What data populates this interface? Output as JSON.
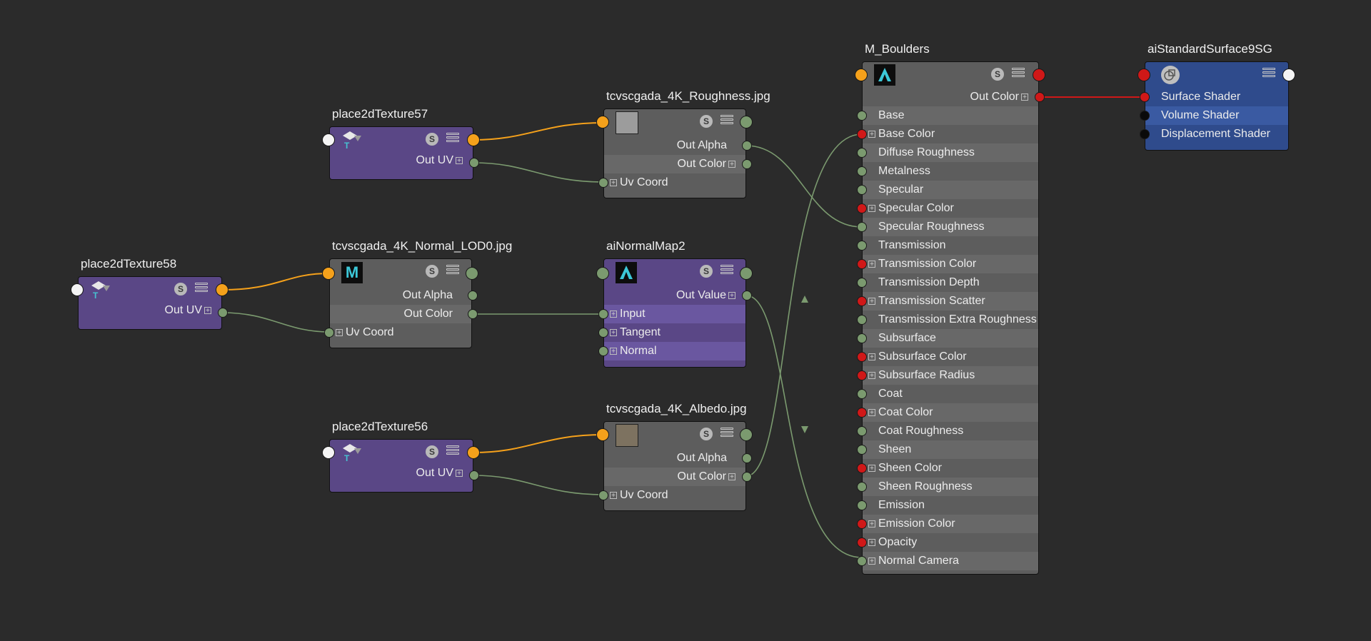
{
  "nodes": {
    "place2d57": {
      "title": "place2dTexture57",
      "out_uv": "Out UV"
    },
    "place2d58": {
      "title": "place2dTexture58",
      "out_uv": "Out UV"
    },
    "place2d56": {
      "title": "place2dTexture56",
      "out_uv": "Out UV"
    },
    "roughness": {
      "title": "tcvscgada_4K_Roughness.jpg",
      "out_alpha": "Out Alpha",
      "out_color": "Out Color",
      "uv_coord": "Uv Coord"
    },
    "normal_tex": {
      "title": "tcvscgada_4K_Normal_LOD0.jpg",
      "out_alpha": "Out Alpha",
      "out_color": "Out Color",
      "uv_coord": "Uv Coord"
    },
    "albedo": {
      "title": "tcvscgada_4K_Albedo.jpg",
      "out_alpha": "Out Alpha",
      "out_color": "Out Color",
      "uv_coord": "Uv Coord"
    },
    "normalmap": {
      "title": "aiNormalMap2",
      "out_value": "Out Value",
      "input": "Input",
      "tangent": "Tangent",
      "normal": "Normal"
    },
    "boulders": {
      "title": "M_Boulders",
      "out_color": "Out Color",
      "attrs": [
        "Base",
        "Base Color",
        "Diffuse Roughness",
        "Metalness",
        "Specular",
        "Specular Color",
        "Specular Roughness",
        "Transmission",
        "Transmission Color",
        "Transmission Depth",
        "Transmission Scatter",
        "Transmission Extra Roughness",
        "Subsurface",
        "Subsurface Color",
        "Subsurface Radius",
        "Coat",
        "Coat Color",
        "Coat Roughness",
        "Sheen",
        "Sheen Color",
        "Sheen Roughness",
        "Emission",
        "Emission Color",
        "Opacity",
        "Normal Camera"
      ]
    },
    "sg": {
      "title": "aiStandardSurface9SG",
      "surface": "Surface Shader",
      "volume": "Volume Shader",
      "displacement": "Displacement Shader"
    }
  },
  "icons": {
    "swatch_button": "S",
    "maya_logo": "M"
  },
  "colors": {
    "background": "#2b2b2b",
    "connection_uv": "#7b9a6f",
    "connection_color_out": "#f5a11b",
    "connection_shader": "#d01818"
  }
}
